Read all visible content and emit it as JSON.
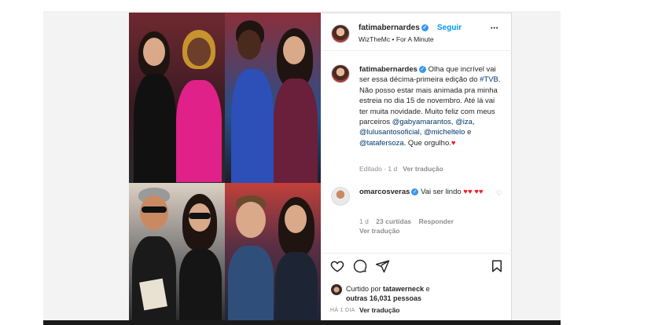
{
  "post": {
    "author": "fatimabernardes",
    "follow_label": "Seguir",
    "audio": "WizTheMc",
    "audio_sep": "•",
    "audio_sub": "For A Minute",
    "more_label": "•••"
  },
  "caption": {
    "author": "fatimabernardes",
    "text_1": "Olha que incrível vai ser essa décima-primeira edição do",
    "hashtag": "#TVB",
    "text_2": ". Não posso estar mais animada pra minha estreia no dia 15 de novembro. Até lá vai ter muita novidade. Muito feliz com meus parceiros",
    "mention_1": "@gabyamarantos",
    "sep_1": ",",
    "mention_2": "@iza",
    "sep_2": ",",
    "mention_3": "@lulusantosoficial",
    "sep_3": ",",
    "mention_4": "@micheltelo",
    "sep_4": "e",
    "mention_5": "@tatafersoza",
    "text_3": ". Que orgulho.",
    "heart": "♥",
    "edited": "Editado · 1 d",
    "see_translation": "Ver tradução"
  },
  "comment": {
    "author": "omarcosveras",
    "text": "Vai ser lindo",
    "hearts": "♥♥ ♥♥",
    "age": "1 d",
    "likes": "23 curtidas",
    "reply": "Responder",
    "see_translation": "Ver tradução"
  },
  "likes": {
    "prefix": "Curtido por",
    "user": "tatawerneck",
    "joiner": "e",
    "others": "outras 16,031 pessoas"
  },
  "footer": {
    "time": "HÁ 1 DIA",
    "see_translation": "Ver tradução"
  }
}
